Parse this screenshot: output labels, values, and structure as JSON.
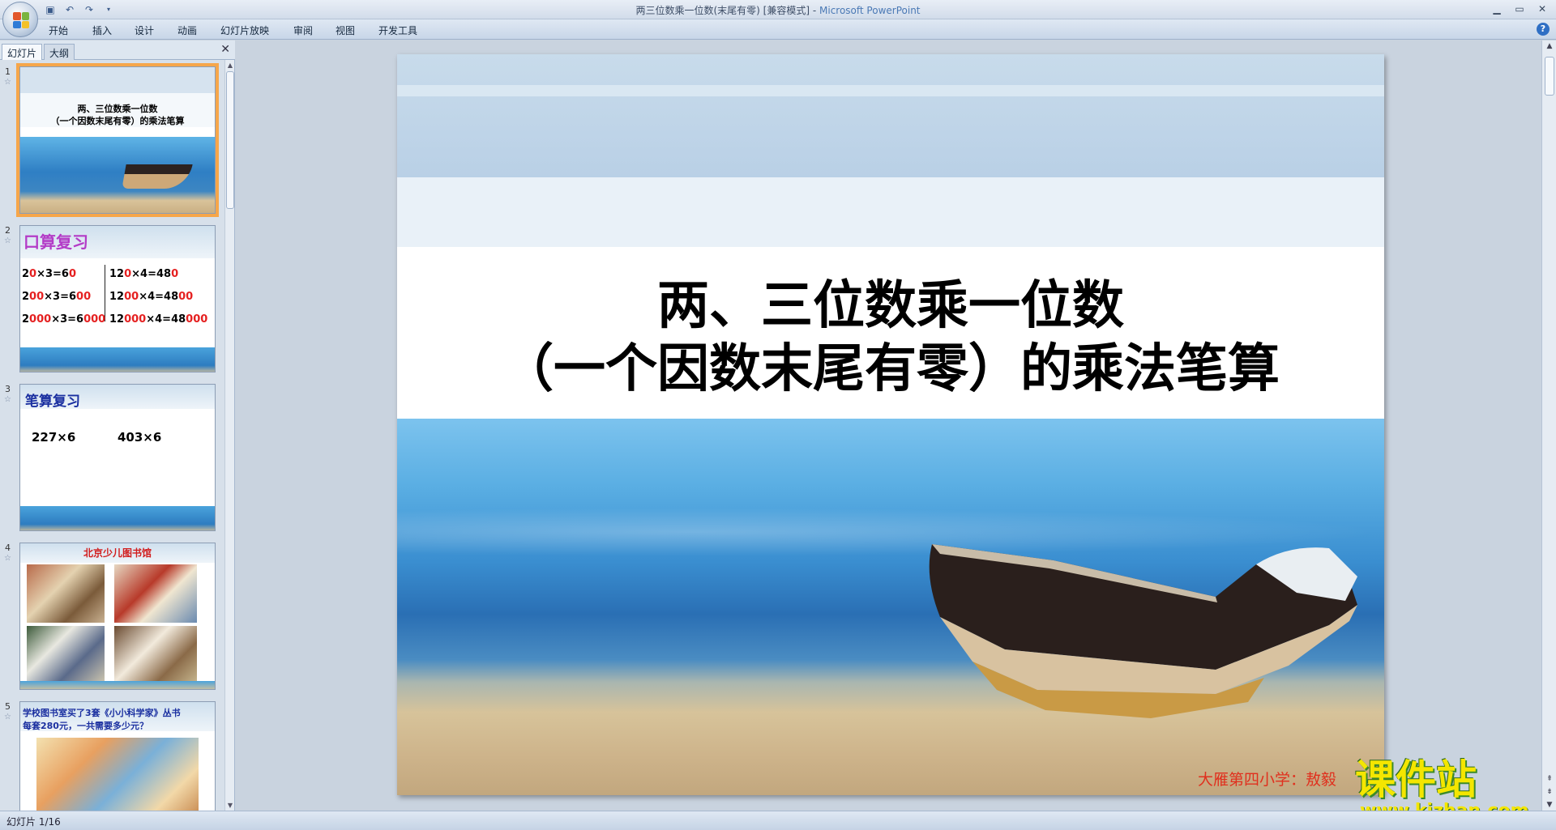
{
  "window": {
    "title": "两三位数乘一位数(末尾有零) [兼容模式] - ",
    "app_name": "Microsoft PowerPoint"
  },
  "quick_access": [
    "save-icon",
    "undo-icon",
    "redo-icon",
    "customize-icon"
  ],
  "ribbon": {
    "tabs": [
      "开始",
      "插入",
      "设计",
      "动画",
      "幻灯片放映",
      "审阅",
      "视图",
      "开发工具"
    ]
  },
  "panel": {
    "tabs": [
      "幻灯片",
      "大纲"
    ]
  },
  "thumbnails": [
    {
      "num": "1",
      "title_line1": "两、三位数乘一位数",
      "title_line2": "（一个因数末尾有零）的乘法笔算"
    },
    {
      "num": "2",
      "heading": "口算复习",
      "left": [
        "20×3=60",
        "200×3=600",
        "2000×3=6000"
      ],
      "right": [
        "120×4=480",
        "1200×4=4800",
        "12000×4=48000"
      ]
    },
    {
      "num": "3",
      "heading": "笔算复习",
      "q1": "227×6",
      "q2": "403×6"
    },
    {
      "num": "4",
      "heading": "北京少儿图书馆"
    },
    {
      "num": "5",
      "text_line1": "学校图书室买了3套《小小科学家》丛书",
      "text_line2": "每套280元，一共需要多少元？"
    }
  ],
  "slide": {
    "title_line1": "两、三位数乘一位数",
    "title_line2": "（一个因数末尾有零）的乘法笔算",
    "author": "大雁第四小学：敖毅"
  },
  "watermark": {
    "big": "课件站",
    "url": "www.kjzhan.com"
  },
  "status": {
    "slide_counter": "幻灯片 1/16"
  }
}
